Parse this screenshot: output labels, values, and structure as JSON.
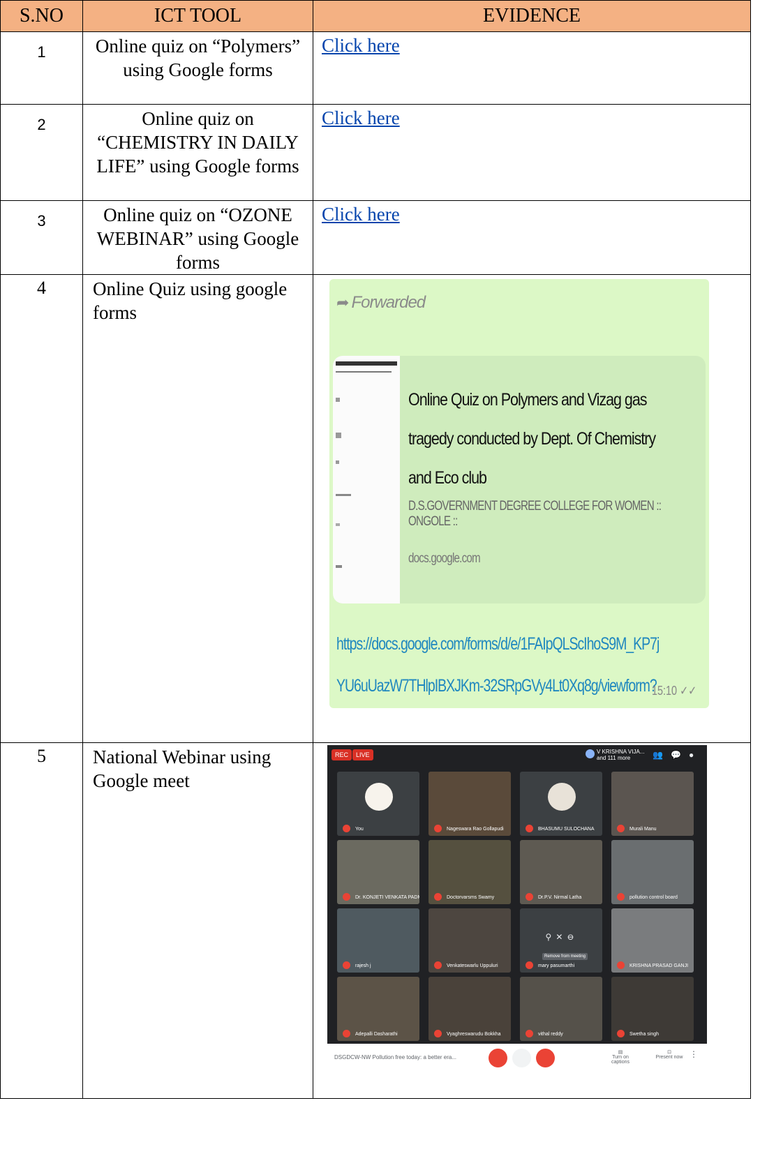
{
  "table": {
    "headers": [
      "S.NO",
      "ICT TOOL",
      "EVIDENCE"
    ],
    "rows": [
      {
        "sno": "1",
        "tool": "Online quiz on “Polymers” using Google forms",
        "evidence": "Click here"
      },
      {
        "sno": "2",
        "tool": "Online quiz on “CHEMISTRY IN DAILY LIFE” using Google forms",
        "evidence": "Click here"
      },
      {
        "sno": "3",
        "tool": "Online quiz on “OZONE WEBINAR” using Google forms",
        "evidence": "Click here"
      },
      {
        "sno": "4",
        "tool": "Online Quiz using google forms"
      },
      {
        "sno": "5",
        "tool": "National Webinar using Google meet"
      }
    ]
  },
  "whatsapp": {
    "forwarded_label": "Forwarded",
    "card_title": "Online Quiz on Polymers and Vizag gas tragedy conducted by Dept. Of Chemistry and Eco club",
    "card_site": "D.S.GOVERNMENT DEGREE COLLEGE FOR WOMEN :: ONGOLE ::",
    "card_domain": "docs.google.com",
    "url": "https://docs.google.com/forms/d/e/1FAIpQLScIhoS9M_KP7jYU6uUazW7THlpIBXJKm-32SRpGVy4Lt0Xq8g/viewform?usp=sf_link",
    "time": "15:10"
  },
  "meet": {
    "rec_label": "REC",
    "live_label": "LIVE",
    "host_name": "V KRISHNA VIJA...",
    "host_more": "and 111 more",
    "participants": [
      "You",
      "Nageswara Rao Gollapudi",
      "BHASUMU SULOCHANA",
      "Murali Manu",
      "Dr. KONJETI VENKATA PADMAVATHI",
      "Doctorvarsms Swamy",
      "Dr.P.V. Nirmal Latha",
      "pollution control board",
      "rajesh j",
      "Venkateswarlu Uppuluri",
      "mary pasumarthi",
      "KRISHNA PRASAD GANJI",
      "Adepalli Dasharathi",
      "Vyaghreswarudu Bokkha",
      "vithal reddy",
      "Swetha singh"
    ],
    "hover_tip": "Remove from meeting",
    "meeting_title": "DSGDCW-NW Pollution free today: a better era...",
    "captions_label": "Turn on captions",
    "present_label": "Present now",
    "colors": {
      "bg": "#202124",
      "tile": "#3c4043",
      "red": "#ea4335"
    }
  }
}
